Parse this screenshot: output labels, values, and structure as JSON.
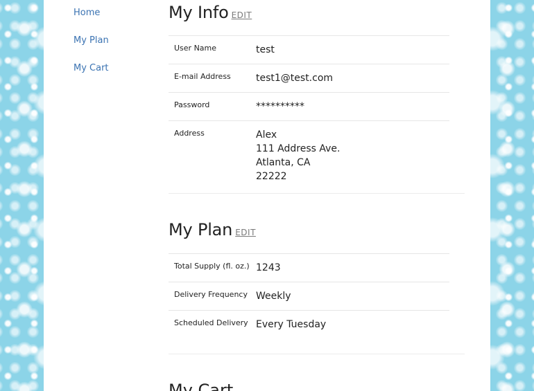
{
  "sidebar": {
    "items": [
      {
        "label": "Home"
      },
      {
        "label": "My Plan"
      },
      {
        "label": "My Cart"
      }
    ]
  },
  "my_info": {
    "title": "My Info",
    "edit_label": "EDIT",
    "rows": [
      {
        "label": "User Name",
        "value": "test"
      },
      {
        "label": "E-mail Address",
        "value": "test1@test.com"
      },
      {
        "label": "Password",
        "value": "**********"
      },
      {
        "label": "Address",
        "value_lines": [
          "Alex",
          "111 Address Ave.",
          "Atlanta, CA",
          "22222"
        ]
      }
    ]
  },
  "my_plan": {
    "title": "My Plan",
    "edit_label": "EDIT",
    "rows": [
      {
        "label": "Total Supply (fl. oz.)",
        "value": "1243"
      },
      {
        "label": "Delivery Frequency",
        "value": "Weekly"
      },
      {
        "label": "Scheduled Delivery",
        "value": "Every Tuesday"
      }
    ]
  },
  "my_cart": {
    "title": "My Cart"
  },
  "colors": {
    "link": "#3b73b2",
    "text": "#222222",
    "rule": "#e6e6e6",
    "background": "#8fd3e6",
    "page": "#ffffff"
  }
}
